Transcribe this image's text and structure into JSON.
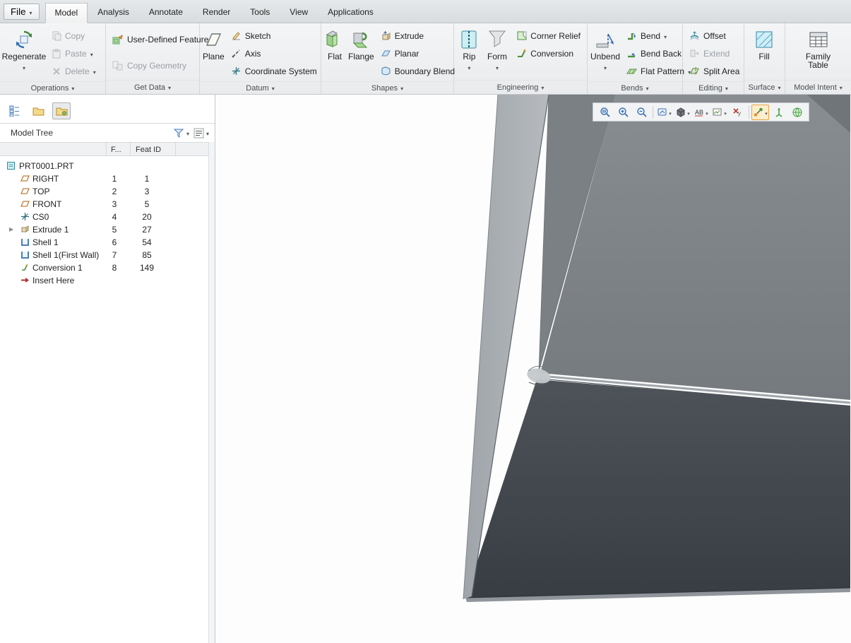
{
  "window": {
    "file_button": "File"
  },
  "tabs": [
    {
      "label": "Model",
      "active": true
    },
    {
      "label": "Analysis",
      "active": false
    },
    {
      "label": "Annotate",
      "active": false
    },
    {
      "label": "Render",
      "active": false
    },
    {
      "label": "Tools",
      "active": false
    },
    {
      "label": "View",
      "active": false
    },
    {
      "label": "Applications",
      "active": false
    }
  ],
  "ribbon": {
    "operations": {
      "label": "Operations",
      "regenerate": "Regenerate",
      "copy": "Copy",
      "paste": "Paste",
      "delete": "Delete"
    },
    "get_data": {
      "label": "Get Data",
      "udf": "User-Defined Feature",
      "copy_geometry": "Copy Geometry"
    },
    "datum": {
      "label": "Datum",
      "plane": "Plane",
      "sketch": "Sketch",
      "axis": "Axis",
      "csys": "Coordinate System"
    },
    "shapes": {
      "label": "Shapes",
      "flat": "Flat",
      "flange": "Flange",
      "extrude": "Extrude",
      "planar": "Planar",
      "boundary_blend": "Boundary Blend"
    },
    "engineering": {
      "label": "Engineering",
      "rip": "Rip",
      "form": "Form",
      "corner_relief": "Corner Relief",
      "conversion": "Conversion"
    },
    "bends": {
      "label": "Bends",
      "unbend": "Unbend",
      "bend": "Bend",
      "bend_back": "Bend Back",
      "flat_pattern": "Flat Pattern"
    },
    "editing": {
      "label": "Editing",
      "offset": "Offset",
      "extend": "Extend",
      "split_area": "Split Area"
    },
    "surface": {
      "label": "Surface",
      "fill": "Fill"
    },
    "model_intent": {
      "label": "Model Intent",
      "family_table": "Family Table"
    }
  },
  "model_tree": {
    "title": "Model Tree",
    "columns": {
      "f": "F...",
      "feat_id": "Feat ID"
    },
    "rows": [
      {
        "label": "PRT0001.PRT",
        "f": "",
        "feat_id": ""
      },
      {
        "label": "RIGHT",
        "f": "1",
        "feat_id": "1"
      },
      {
        "label": "TOP",
        "f": "2",
        "feat_id": "3"
      },
      {
        "label": "FRONT",
        "f": "3",
        "feat_id": "5"
      },
      {
        "label": "CS0",
        "f": "4",
        "feat_id": "20"
      },
      {
        "label": "Extrude 1",
        "f": "5",
        "feat_id": "27"
      },
      {
        "label": "Shell 1",
        "f": "6",
        "feat_id": "54"
      },
      {
        "label": "Shell 1(First Wall)",
        "f": "7",
        "feat_id": "85"
      },
      {
        "label": "Conversion 1",
        "f": "8",
        "feat_id": "149"
      },
      {
        "label": "Insert Here",
        "f": "",
        "feat_id": ""
      }
    ]
  },
  "graphics_toolbar": {
    "icons": [
      "zoom-refit",
      "zoom-in",
      "zoom-out",
      "repaint",
      "display-style",
      "annotation-display",
      "saved-orientations",
      "erase-dims",
      "datum-display-filters",
      "spin-center",
      "view-manager"
    ],
    "selected": "datum-display-filters"
  },
  "colors": {
    "face_light": "#aab0b5",
    "face_mid": "#7e8388",
    "face_dark": "#43494f",
    "selection_accent": "#e8a33d"
  }
}
